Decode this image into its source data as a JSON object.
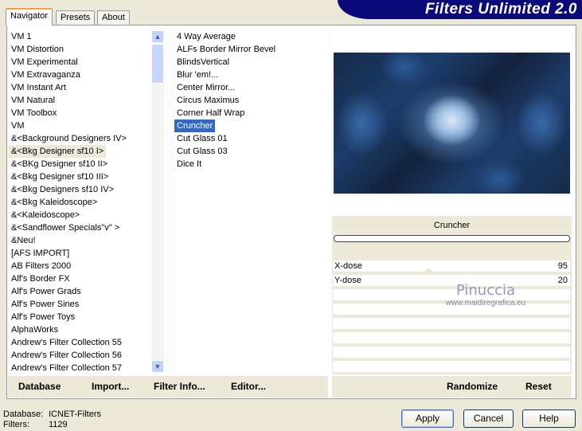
{
  "tabs": [
    "Navigator",
    "Presets",
    "About"
  ],
  "banner": "Filters Unlimited 2.0",
  "categories": [
    "VM 1",
    "VM Distortion",
    "VM Experimental",
    "VM Extravaganza",
    "VM Instant Art",
    "VM Natural",
    "VM Toolbox",
    "VM",
    "&<Background Designers IV>",
    "&<Bkg Designer sf10 I>",
    "&<BKg Designer sf10 II>",
    "&<Bkg Designer sf10 III>",
    "&<Bkg Designers sf10 IV>",
    "&<Bkg Kaleidoscope>",
    "&<Kaleidoscope>",
    "&<Sandflower Specials\"v\" >",
    "&Neu!",
    "[AFS IMPORT]",
    "AB Filters 2000",
    "Alf's Border FX",
    "Alf's Power Grads",
    "Alf's Power Sines",
    "Alf's Power Toys",
    "AlphaWorks",
    "Andrew's Filter Collection 55",
    "Andrew's Filter Collection 56",
    "Andrew's Filter Collection 57"
  ],
  "selected_category": "&<Bkg Designer sf10 I>",
  "filters": [
    "4 Way Average",
    "ALFs Border Mirror Bevel",
    "BlindsVertical",
    "Blur 'em!...",
    "Center Mirror...",
    "Circus Maximus",
    "Corner Half Wrap",
    "Cruncher",
    "Cut Glass 01",
    "Cut Glass 03",
    "Dice It"
  ],
  "selected_filter": "Cruncher",
  "preview": {
    "filter_name": "Cruncher",
    "watermark": "Pinuccia",
    "watermark_url": "www.maidiregrafica.eu"
  },
  "params": [
    {
      "label": "X-dose",
      "value": 95
    },
    {
      "label": "Y-dose",
      "value": 20
    }
  ],
  "left_buttons": [
    "Database",
    "Import...",
    "Filter Info...",
    "Editor..."
  ],
  "right_buttons": [
    "Randomize",
    "Reset"
  ],
  "status": {
    "db_label": "Database:",
    "db_value": "ICNET-Filters",
    "filters_label": "Filters:",
    "filters_value": "1129"
  },
  "dialog_buttons": [
    "Apply",
    "Cancel",
    "Help"
  ]
}
